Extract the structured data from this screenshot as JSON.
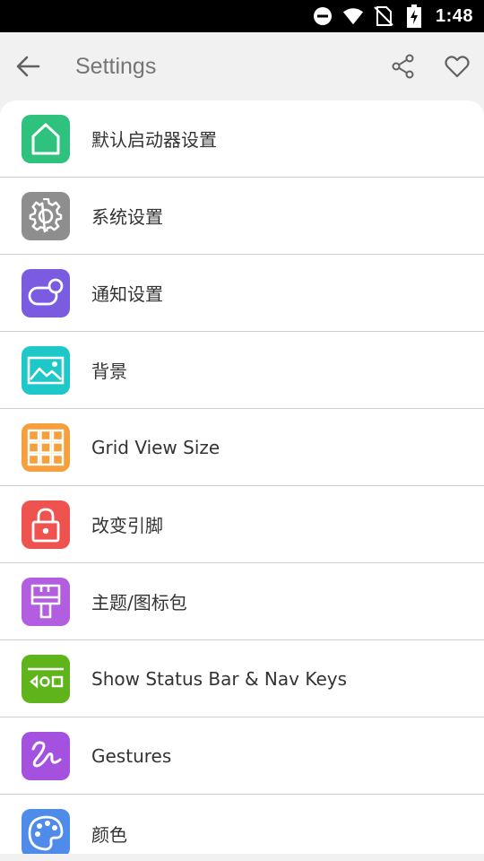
{
  "status_bar": {
    "time": "1:48",
    "icons": [
      "do-not-disturb-icon",
      "wifi-icon",
      "no-sim-icon",
      "battery-charging-icon"
    ]
  },
  "app_bar": {
    "title": "Settings",
    "back_icon": "arrow-left-icon",
    "actions": [
      "share-icon",
      "heart-icon"
    ]
  },
  "settings": {
    "items": [
      {
        "label": "默认启动器设置",
        "icon": "home-icon",
        "color": "#2ec27e"
      },
      {
        "label": "系统设置",
        "icon": "gear-icon",
        "color": "#8e8e8e"
      },
      {
        "label": "通知设置",
        "icon": "notification-icon",
        "color": "#7b5ce0"
      },
      {
        "label": "背景",
        "icon": "image-icon",
        "color": "#1ec8c8"
      },
      {
        "label": "Grid View Size",
        "icon": "grid-icon",
        "color": "#f5a03c"
      },
      {
        "label": "改变引脚",
        "icon": "lock-icon",
        "color": "#ef5350"
      },
      {
        "label": "主题/图标包",
        "icon": "paint-brush-icon",
        "color": "#b35ee0"
      },
      {
        "label": "Show Status Bar & Nav Keys",
        "icon": "nav-keys-icon",
        "color": "#5fb41c"
      },
      {
        "label": "Gestures",
        "icon": "gesture-icon",
        "color": "#a551e0"
      },
      {
        "label": "颜色",
        "icon": "palette-icon",
        "color": "#4f8be8"
      }
    ]
  }
}
